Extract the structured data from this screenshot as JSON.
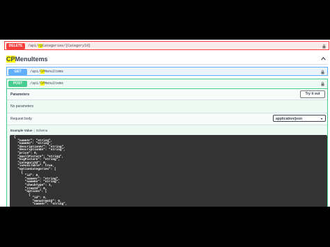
{
  "delete_op": {
    "method": "DELETE",
    "path_prefix": "/api/",
    "path_highlight": "cp",
    "path_suffix": "Categories/{CategoryId}"
  },
  "section": {
    "title_highlight": "CP",
    "title_rest": "MenuItems"
  },
  "get_op": {
    "method": "GET",
    "path_prefix": "/api/",
    "path_highlight": "CP",
    "path_suffix": "MenuItems"
  },
  "post_op": {
    "method": "POST",
    "path_prefix": "/api/",
    "path_highlight": "CP",
    "path_suffix": "MenuItems",
    "parameters_label": "Parameters",
    "try_label": "Try it out",
    "no_params": "No parameters",
    "request_body_label": "Request body",
    "content_type": "application/json",
    "example_value_label": "Example Value",
    "schema_label": "Schema",
    "code_lines": [
      "{",
      "  \"nameAr\": \"string\",",
      "  \"nameEn\": \"string\",",
      "  \"descriptionAr\": \"string\",",
      "  \"descriptionEn\": \"string\",",
      "  \"price\": 0,",
      "  \"smallPicture\": \"string\",",
      "  \"bigPicture\": \"string\",",
      "  \"categoryId\": 0,",
      "  \"isAvailable\": true,",
      "  \"optionCategories\": [",
      "    {",
      "      \"id\": 0,",
      "      \"nameAr\": \"string\",",
      "      \"nameEn\": \"string\",",
      "      \"checkType\": 1,",
      "      \"itemId\": 0,",
      "      \"options\": [",
      "        {",
      "          \"id\": 0,",
      "          \"menuItemId\": 0,",
      "          \"nameAr\": \"string\","
    ]
  },
  "icons": {
    "lock": "lock-icon",
    "chevron": "chevron-up-icon",
    "caret": "chevron-down-icon"
  },
  "colors": {
    "delete": "#f93e3e",
    "get": "#61affe",
    "post": "#49cc90",
    "highlight": "#ffff00"
  }
}
